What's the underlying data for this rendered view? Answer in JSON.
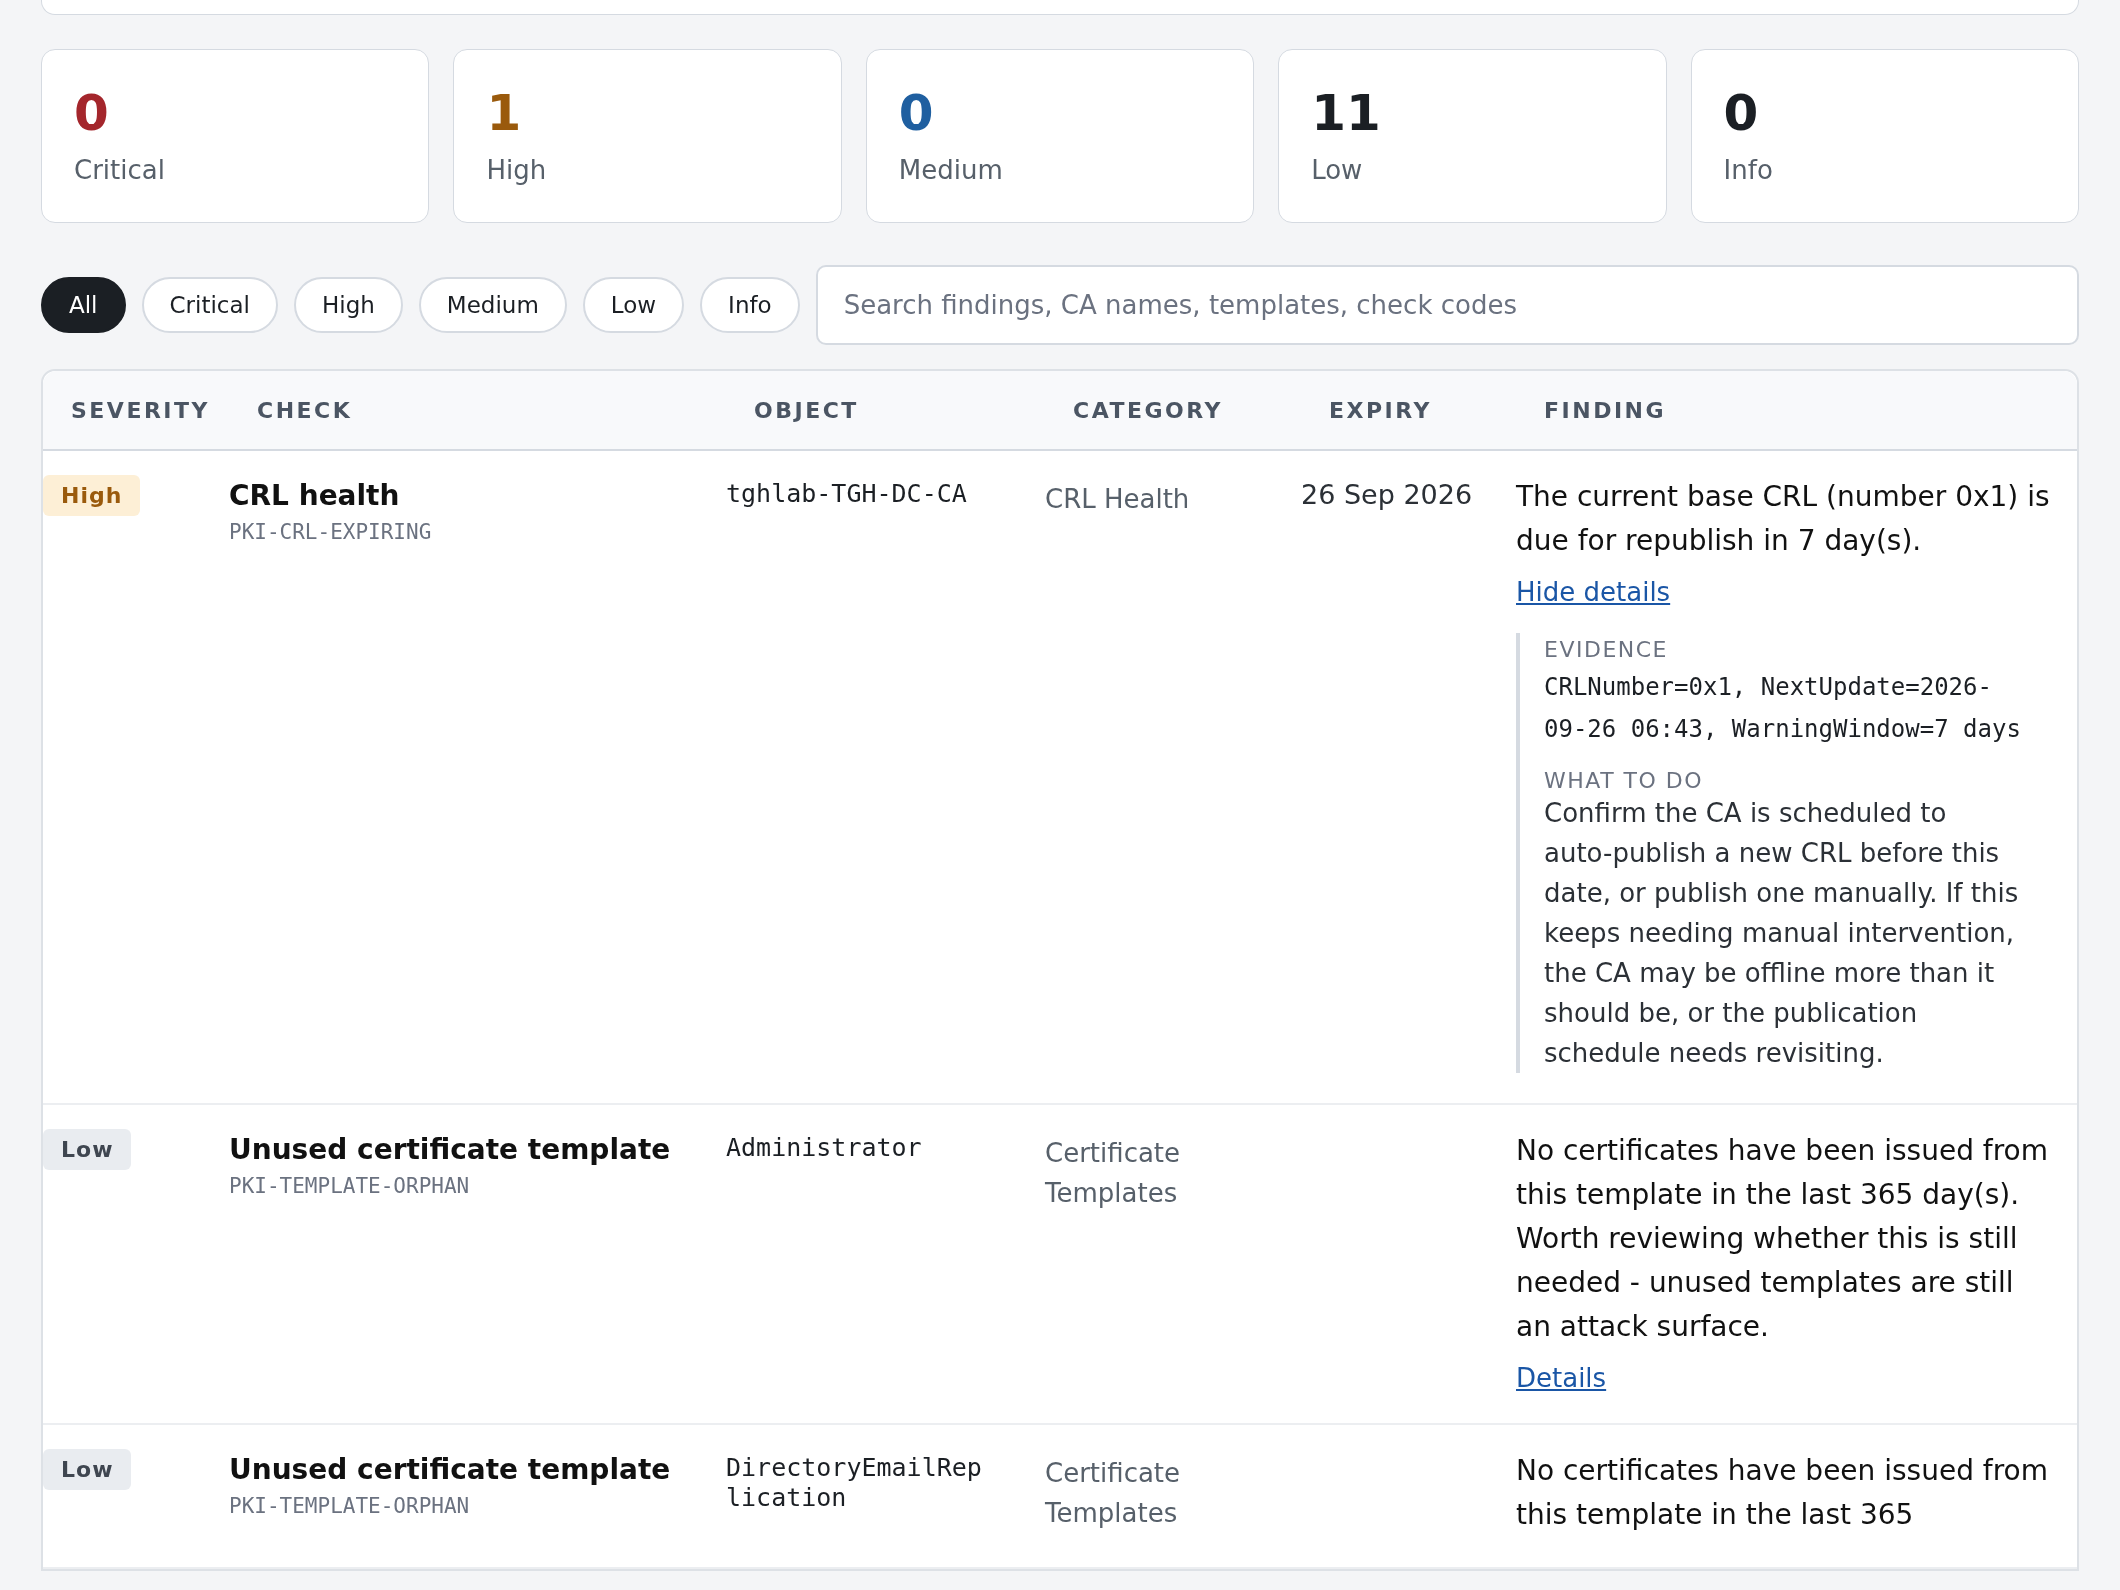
{
  "stats": [
    {
      "count": "0",
      "label": "Critical",
      "color": "#a4262c"
    },
    {
      "count": "1",
      "label": "High",
      "color": "#9a5a0c"
    },
    {
      "count": "0",
      "label": "Medium",
      "color": "#1f5fa0"
    },
    {
      "count": "11",
      "label": "Low",
      "color": "#1b1f24"
    },
    {
      "count": "0",
      "label": "Info",
      "color": "#1b1f24"
    }
  ],
  "filters": [
    {
      "label": "All",
      "selected": true
    },
    {
      "label": "Critical",
      "selected": false
    },
    {
      "label": "High",
      "selected": false
    },
    {
      "label": "Medium",
      "selected": false
    },
    {
      "label": "Low",
      "selected": false
    },
    {
      "label": "Info",
      "selected": false
    }
  ],
  "search": {
    "placeholder": "Search findings, CA names, templates, check codes"
  },
  "table": {
    "columns": [
      "SEVERITY",
      "CHECK",
      "OBJECT",
      "CATEGORY",
      "EXPIRY",
      "FINDING"
    ],
    "rows": [
      {
        "severity": {
          "label": "High",
          "kind": "high"
        },
        "check": "CRL health",
        "code": "PKI-CRL-EXPIRING",
        "object": "tghlab-TGH-DC-CA",
        "category": "CRL Health",
        "expiry": "26 Sep 2026",
        "finding": "The current base CRL (number 0x1) is due for republish in 7 day(s).",
        "details_link": "Hide details",
        "evidence_label": "EVIDENCE",
        "evidence": "CRLNumber=0x1, NextUpdate=2026-09-26 06:43, WarningWindow=7 days",
        "action_label": "WHAT TO DO",
        "action": "Confirm the CA is scheduled to auto-publish a new CRL before this date, or publish one manually. If this keeps needing manual intervention, the CA may be offline more than it should be, or the publication schedule needs revisiting."
      },
      {
        "severity": {
          "label": "Low",
          "kind": "low"
        },
        "check": "Unused certificate template",
        "code": "PKI-TEMPLATE-ORPHAN",
        "object": "Administrator",
        "category": "Certificate Templates",
        "finding": "No certificates have been issued from this template in the last 365 day(s). Worth reviewing whether this is still needed - unused templates are still an attack surface.",
        "details_link": "Details"
      },
      {
        "severity": {
          "label": "Low",
          "kind": "low"
        },
        "check": "Unused certificate template",
        "code": "PKI-TEMPLATE-ORPHAN",
        "object": "DirectoryEmailReplication",
        "category": "Certificate Templates",
        "finding": "No certificates have been issued from this template in the last 365"
      }
    ]
  }
}
